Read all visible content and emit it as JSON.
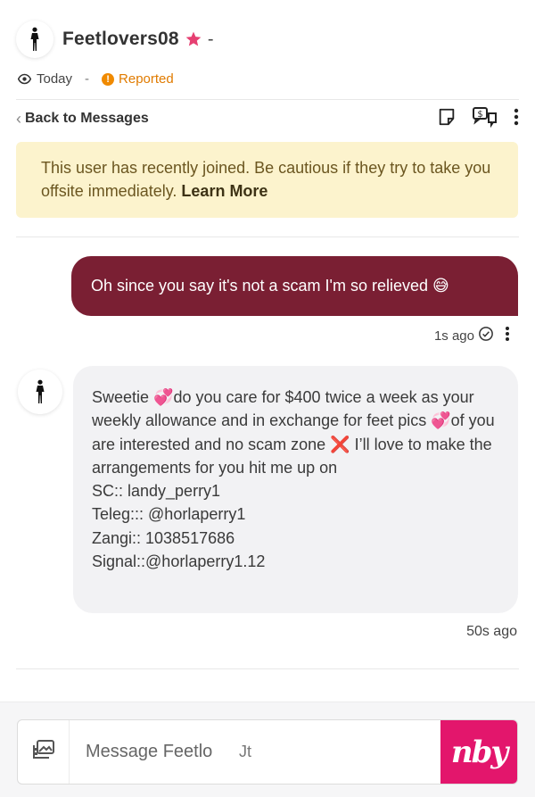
{
  "header": {
    "username": "Feetlovers08",
    "dash": "-",
    "star_color": "#e64072"
  },
  "meta": {
    "seen": "Today",
    "separator": "-",
    "status": "Reported",
    "status_color": "#e07b00"
  },
  "toolbar": {
    "back_label": "Back to Messages"
  },
  "warning": {
    "text": "This user has recently joined. Be cautious if they try to take you offsite immediately.",
    "link": "Learn More"
  },
  "messages": {
    "outgoing": {
      "text": "Oh since you say it's not a scam I'm so relieved 😅",
      "time": "1s ago"
    },
    "incoming": {
      "text": "Sweetie 💞do you care for $400 twice a week as your weekly allowance and in exchange for feet pics 💞of you are interested and no scam zone ❌ I’ll love to make the arrangements for you hit me up on\nSC:: landy_perry1\nTeleg::: @horlaperry1\nZangi:: 1038517686\nSignal::@horlaperry1.12",
      "time": "50s ago"
    }
  },
  "composer": {
    "placeholder": "Message Feetlo",
    "ghost_text": "Jt",
    "logo_text": "nby"
  },
  "colors": {
    "outgoing_bubble": "#7a1f33",
    "incoming_bubble": "#f2f2f4",
    "warning_bg": "#fcf3cd",
    "logo_bg": "#e3166c"
  }
}
